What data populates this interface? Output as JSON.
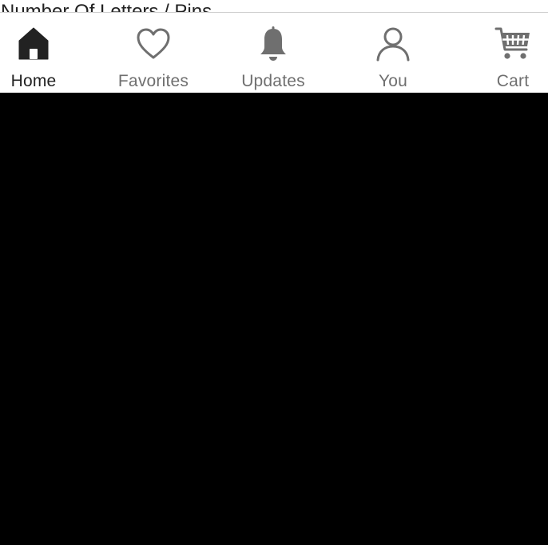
{
  "peek": {
    "section_label": "Number Of Letters / Pins"
  },
  "tab_bar": {
    "active_color": "#222222",
    "inactive_color": "#6f6f6f",
    "tabs": [
      {
        "label": "Home",
        "icon": "home-icon",
        "active": true
      },
      {
        "label": "Favorites",
        "icon": "heart-icon",
        "active": false
      },
      {
        "label": "Updates",
        "icon": "bell-icon",
        "active": false
      },
      {
        "label": "You",
        "icon": "person-icon",
        "active": false
      },
      {
        "label": "Cart",
        "icon": "cart-icon",
        "active": false
      }
    ]
  }
}
